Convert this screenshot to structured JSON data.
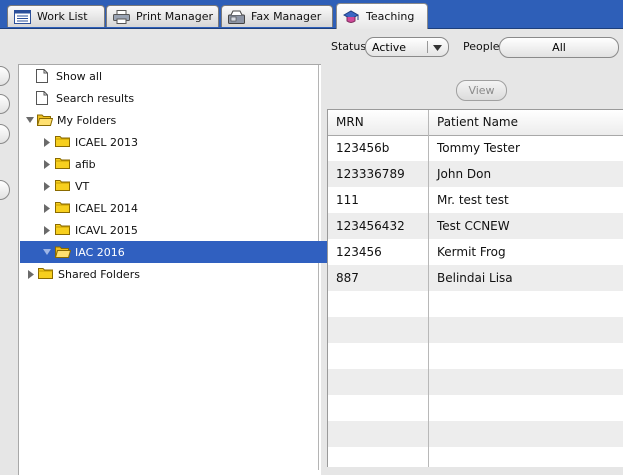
{
  "tabs": [
    {
      "label": "Work List",
      "icon": "list-icon"
    },
    {
      "label": "Print Manager",
      "icon": "printer-icon"
    },
    {
      "label": "Fax Manager",
      "icon": "fax-icon"
    },
    {
      "label": "Teaching",
      "icon": "teaching-icon",
      "active": true
    }
  ],
  "toolbar": {
    "status_label": "Status",
    "status_value": "Active",
    "people_label": "People",
    "people_value": "All"
  },
  "tree": {
    "items": [
      {
        "label": "Show all",
        "icon": "page-icon"
      },
      {
        "label": "Search results",
        "icon": "page-icon"
      },
      {
        "label": "My Folders",
        "icon": "folder-open-icon",
        "expanded": true
      },
      {
        "label": "ICAEL 2013",
        "icon": "folder-icon"
      },
      {
        "label": "afib",
        "icon": "folder-icon"
      },
      {
        "label": "VT",
        "icon": "folder-icon"
      },
      {
        "label": "ICAEL 2014",
        "icon": "folder-icon"
      },
      {
        "label": "ICAVL 2015",
        "icon": "folder-icon"
      },
      {
        "label": "IAC 2016",
        "icon": "folder-open-icon",
        "selected": true
      },
      {
        "label": "Shared Folders",
        "icon": "folder-icon"
      }
    ]
  },
  "view_button": {
    "label": "View",
    "enabled": false
  },
  "table": {
    "columns": [
      "MRN",
      "Patient Name"
    ],
    "rows": [
      [
        "123456b",
        "Tommy Tester"
      ],
      [
        "123336789",
        "John Don"
      ],
      [
        "111",
        "Mr. test test"
      ],
      [
        "123456432",
        "Test CCNEW"
      ],
      [
        "123456",
        "Kermit Frog"
      ],
      [
        "887",
        "Belindai Lisa"
      ]
    ]
  },
  "colors": {
    "tabbar": "#2e5fb8",
    "selection": "#3060c0",
    "disabled_text": "#8a8a8a"
  }
}
